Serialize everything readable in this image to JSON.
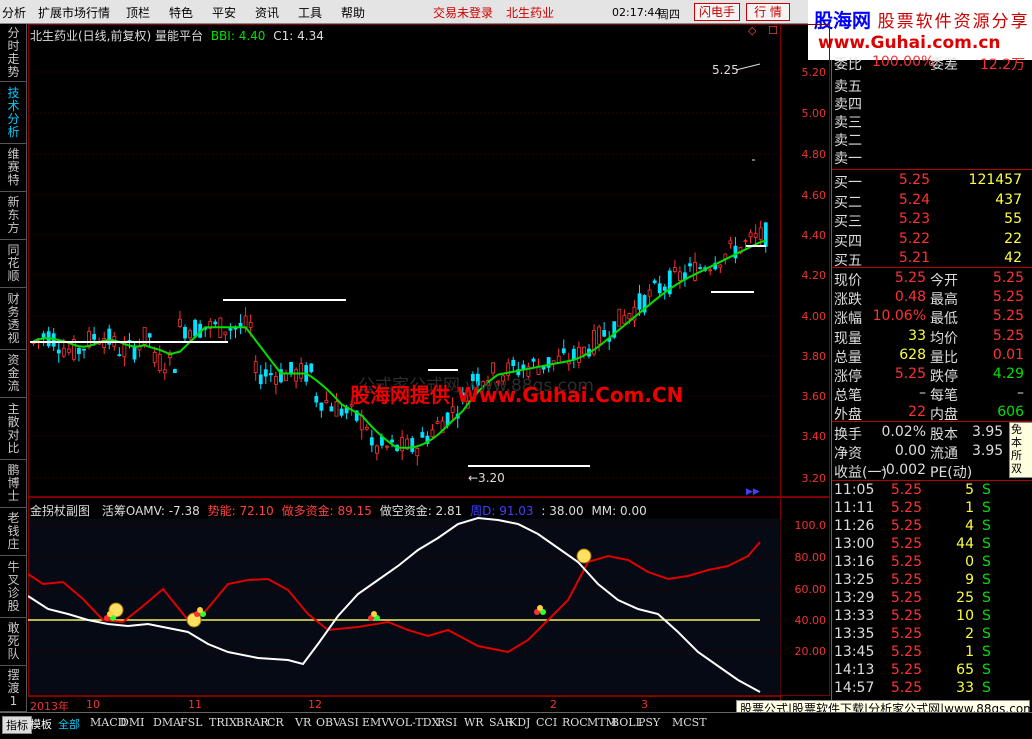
{
  "menu": {
    "items": [
      "分析",
      "扩展市场行情",
      "顶栏",
      "特色",
      "平安",
      "资讯",
      "工具",
      "帮助"
    ],
    "trade_status": "交易未登录",
    "stock_name": "北生药业",
    "time": "02:17:44",
    "weekday": "周四",
    "flash_button": "闪电手",
    "quote_button": "行  情"
  },
  "banner": {
    "title": "股海网",
    "subtitle": "股票软件资源分享",
    "url": "www.Guhai.com.cn"
  },
  "left_nav": [
    "分时走势",
    "技术分析",
    "维赛特",
    "新东方",
    "同花顺",
    "财务透视",
    "资金流",
    "主散对比",
    "鹏博士",
    "老钱庄",
    "牛叉诊股",
    "敢死队",
    "摆渡1"
  ],
  "main_chart": {
    "title": "北生药业(日线,前复权) 量能平台",
    "bbi_label": "BBI: 4.40",
    "c1_label": "C1: 4.34",
    "high_mark": "5.25",
    "low_mark": "←3.20",
    "y_ticks": [
      "5.20",
      "5.00",
      "4.80",
      "4.60",
      "4.40",
      "4.20",
      "4.00",
      "3.80",
      "3.60",
      "3.40",
      "3.20"
    ],
    "watermark_gray": "公式家公式网 www.88gs.com",
    "watermark_red": "股海网提供 Www.Guhai.Com.CN"
  },
  "sub_chart": {
    "title": "金拐杖副图",
    "oamv": "活筹OAMV: -7.38",
    "momentum": "势能: 72.10",
    "long_funds": "做多资金: 89.15",
    "short_funds": "做空资金: 2.81",
    "cycle": "周D: 91.03",
    "v38": ": 38.00",
    "mm": "MM: 0.00",
    "y_ticks": [
      "100.0",
      "80.00",
      "60.00",
      "40.00",
      "20.00"
    ]
  },
  "x_axis": [
    "2013年",
    "10",
    "11",
    "12",
    "2",
    "3"
  ],
  "order_book": {
    "header": {
      "label": "委比",
      "value": "100.00%",
      "label2": "委差",
      "value2": "12.2万"
    },
    "asks": [
      "卖五",
      "卖四",
      "卖三",
      "卖二",
      "卖一"
    ],
    "bids": [
      {
        "label": "买一",
        "price": "5.25",
        "vol": "121457"
      },
      {
        "label": "买二",
        "price": "5.24",
        "vol": "437"
      },
      {
        "label": "买三",
        "price": "5.23",
        "vol": "55"
      },
      {
        "label": "买四",
        "price": "5.22",
        "vol": "22"
      },
      {
        "label": "买五",
        "price": "5.21",
        "vol": "42"
      }
    ]
  },
  "quote": [
    {
      "l": "现价",
      "v": "5.25",
      "l2": "今开",
      "v2": "5.25"
    },
    {
      "l": "涨跌",
      "v": "0.48",
      "l2": "最高",
      "v2": "5.25"
    },
    {
      "l": "涨幅",
      "v": "10.06%",
      "l2": "最低",
      "v2": "5.25"
    },
    {
      "l": "现量",
      "v": "33",
      "l2": "均价",
      "v2": "5.25"
    },
    {
      "l": "总量",
      "v": "628",
      "l2": "量比",
      "v2": "0.01"
    },
    {
      "l": "涨停",
      "v": "5.25",
      "l2": "跌停",
      "v2": "4.29"
    },
    {
      "l": "总笔",
      "v": "–",
      "l2": "每笔",
      "v2": "–"
    },
    {
      "l": "外盘",
      "v": "22",
      "l2": "内盘",
      "v2": "606"
    }
  ],
  "fundamentals": [
    {
      "l": "换手",
      "v": "0.02%",
      "l2": "股本",
      "v2": "3.95"
    },
    {
      "l": "净资",
      "v": "0.00",
      "l2": "流通",
      "v2": "3.95"
    },
    {
      "l": "收益(一)",
      "v": "-0.002",
      "l2": "PE(动)",
      "v2": ""
    }
  ],
  "ticks": [
    {
      "t": "11:05",
      "p": "5.25",
      "v": "5",
      "s": "S"
    },
    {
      "t": "11:11",
      "p": "5.25",
      "v": "1",
      "s": "S"
    },
    {
      "t": "11:26",
      "p": "5.25",
      "v": "4",
      "s": "S"
    },
    {
      "t": "13:00",
      "p": "5.25",
      "v": "44",
      "s": "S"
    },
    {
      "t": "13:16",
      "p": "5.25",
      "v": "0",
      "s": "S"
    },
    {
      "t": "13:25",
      "p": "5.25",
      "v": "9",
      "s": "S"
    },
    {
      "t": "13:29",
      "p": "5.25",
      "v": "25",
      "s": "S"
    },
    {
      "t": "13:33",
      "p": "5.25",
      "v": "10",
      "s": "S"
    },
    {
      "t": "13:35",
      "p": "5.25",
      "v": "2",
      "s": "S"
    },
    {
      "t": "13:45",
      "p": "5.25",
      "v": "1",
      "s": "S"
    },
    {
      "t": "14:13",
      "p": "5.25",
      "v": "65",
      "s": "S"
    },
    {
      "t": "14:57",
      "p": "5.25",
      "v": "33",
      "s": "S"
    }
  ],
  "indicator_tabs": [
    "指标",
    "模板",
    "全部",
    "MACD",
    "DMI",
    "DMA",
    "FSL",
    "TRIX",
    "BRAR",
    "CR",
    "VR",
    "OBV",
    "ASI",
    "EMV",
    "VOL-TDX",
    "RSI",
    "WR",
    "SAR",
    "KDJ",
    "CCI",
    "ROC",
    "MTM",
    "BOLL",
    "PSY",
    "MCST"
  ],
  "footer_ad": "股票公式|股票软件下载|分析家公式网|www.88gs.com",
  "colors": {
    "up": "#ff3232",
    "down": "#00ffff",
    "bbi": "#00e000",
    "grid": "#800000"
  }
}
